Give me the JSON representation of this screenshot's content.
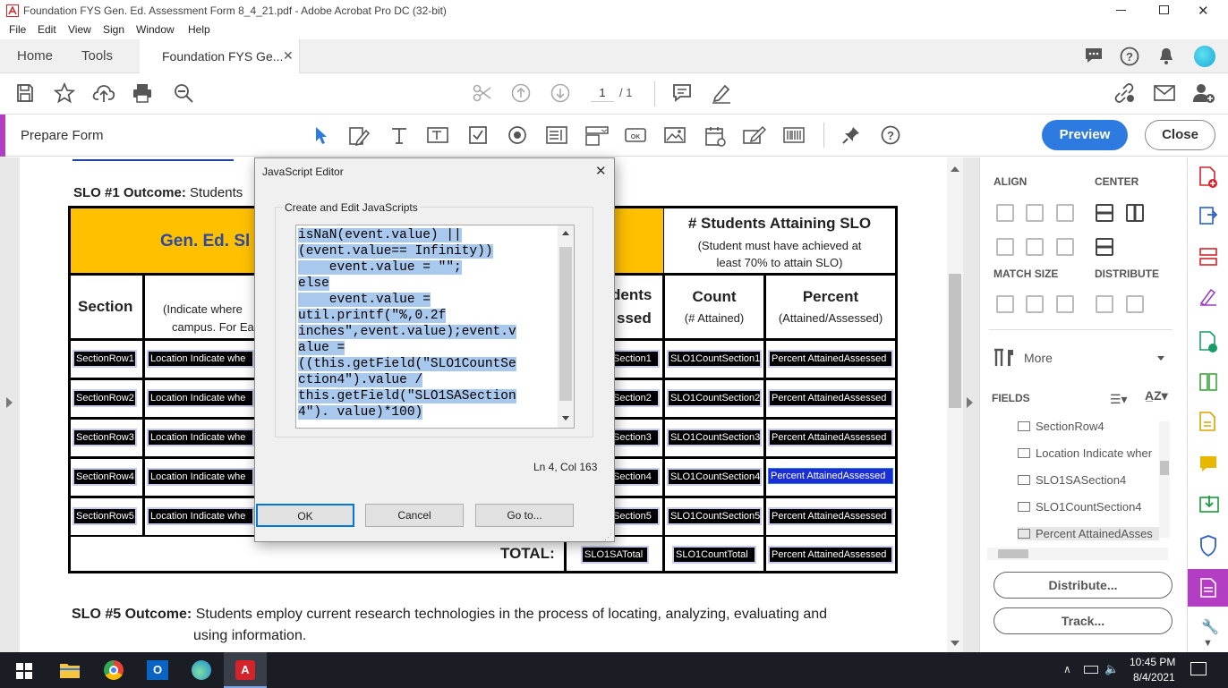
{
  "window": {
    "title": "Foundation FYS Gen. Ed. Assessment Form 8_4_21.pdf - Adobe Acrobat Pro DC (32-bit)"
  },
  "menu": [
    "File",
    "Edit",
    "View",
    "Sign",
    "Window",
    "Help"
  ],
  "tabs": {
    "home": "Home",
    "tools": "Tools",
    "doc": "Foundation FYS Ge..."
  },
  "toolbar": {
    "page_current": "1",
    "page_total": "/ 1"
  },
  "prepare": {
    "label": "Prepare Form",
    "preview": "Preview",
    "close": "Close"
  },
  "document": {
    "slo1_label": "SLO #1 Outcome:",
    "slo1_text": "Students",
    "header_gened": "Gen. Ed. Sl",
    "header_attaining": "# Students Attaining SLO",
    "header_attaining_sub": "(Student must have achieved at least 70% to attain SLO)",
    "col_section": "Section",
    "col_location": "(Indicate where",
    "col_location2": "campus. For Ea",
    "col_assessed": "dents",
    "col_assessed2": "ssed",
    "col_count": "Count",
    "col_count_sub": "(# Attained)",
    "col_percent": "Percent",
    "col_percent_sub": "(Attained/Assessed)",
    "rows": [
      {
        "section": "SectionRow1",
        "location": "Location Indicate whe",
        "sa": "Section1",
        "count": "SLO1CountSection1",
        "percent": "Percent AttainedAssessed"
      },
      {
        "section": "SectionRow2",
        "location": "Location Indicate whe",
        "sa": "Section2",
        "count": "SLO1CountSection2",
        "percent": "Percent AttainedAssessed"
      },
      {
        "section": "SectionRow3",
        "location": "Location Indicate whe",
        "sa": "Section3",
        "count": "SLO1CountSection3",
        "percent": "Percent AttainedAssessed"
      },
      {
        "section": "SectionRow4",
        "location": "Location Indicate whe",
        "sa": "Section4",
        "count": "SLO1CountSection4",
        "percent": "Percent AttainedAssessed"
      },
      {
        "section": "SectionRow5",
        "location": "Location Indicate whe",
        "sa": "Section5",
        "count": "SLO1CountSection5",
        "percent": "Percent AttainedAssessed"
      }
    ],
    "total_label": "TOTAL:",
    "total_sa": "SLO1SATotal",
    "total_count": "SLO1CountTotal",
    "total_percent": "Percent AttainedAssessed",
    "slo5_label": "SLO #5 Outcome:",
    "slo5_text": "Students employ current research technologies in the process of locating, analyzing, evaluating and",
    "slo5_text2": "using information."
  },
  "dialog": {
    "title": "JavaScript Editor",
    "group_label": "Create and Edit JavaScripts",
    "code_lines": [
      "isNaN(event.value) ||",
      "(event.value== Infinity))",
      "    event.value = \"\";",
      "else",
      "    event.value =",
      "util.printf(\"%,0.2f",
      "inches\",event.value);event.v",
      "alue =",
      "((this.getField(\"SLO1CountSe",
      "ction4\").value /",
      "this.getField(\"SLO1SASection",
      "4\"). value)*100)"
    ],
    "cursor_pos": "Ln 4, Col 163",
    "ok": "OK",
    "cancel": "Cancel",
    "goto": "Go to..."
  },
  "panel": {
    "align": "ALIGN",
    "center": "CENTER",
    "match_size": "MATCH SIZE",
    "distribute": "DISTRIBUTE",
    "more": "More",
    "fields": "FIELDS",
    "field_items": [
      "SectionRow4",
      "Location Indicate wher",
      "SLO1SASection4",
      "SLO1CountSection4",
      "Percent AttainedAsses"
    ],
    "distribute_btn": "Distribute...",
    "track_btn": "Track..."
  },
  "taskbar": {
    "time": "10:45 PM",
    "date": "8/4/2021"
  },
  "colors": {
    "accent": "#b33ec4",
    "preview": "#2d7ae0",
    "header_gold": "#ffc000",
    "header_blue": "#2e4aa0"
  }
}
